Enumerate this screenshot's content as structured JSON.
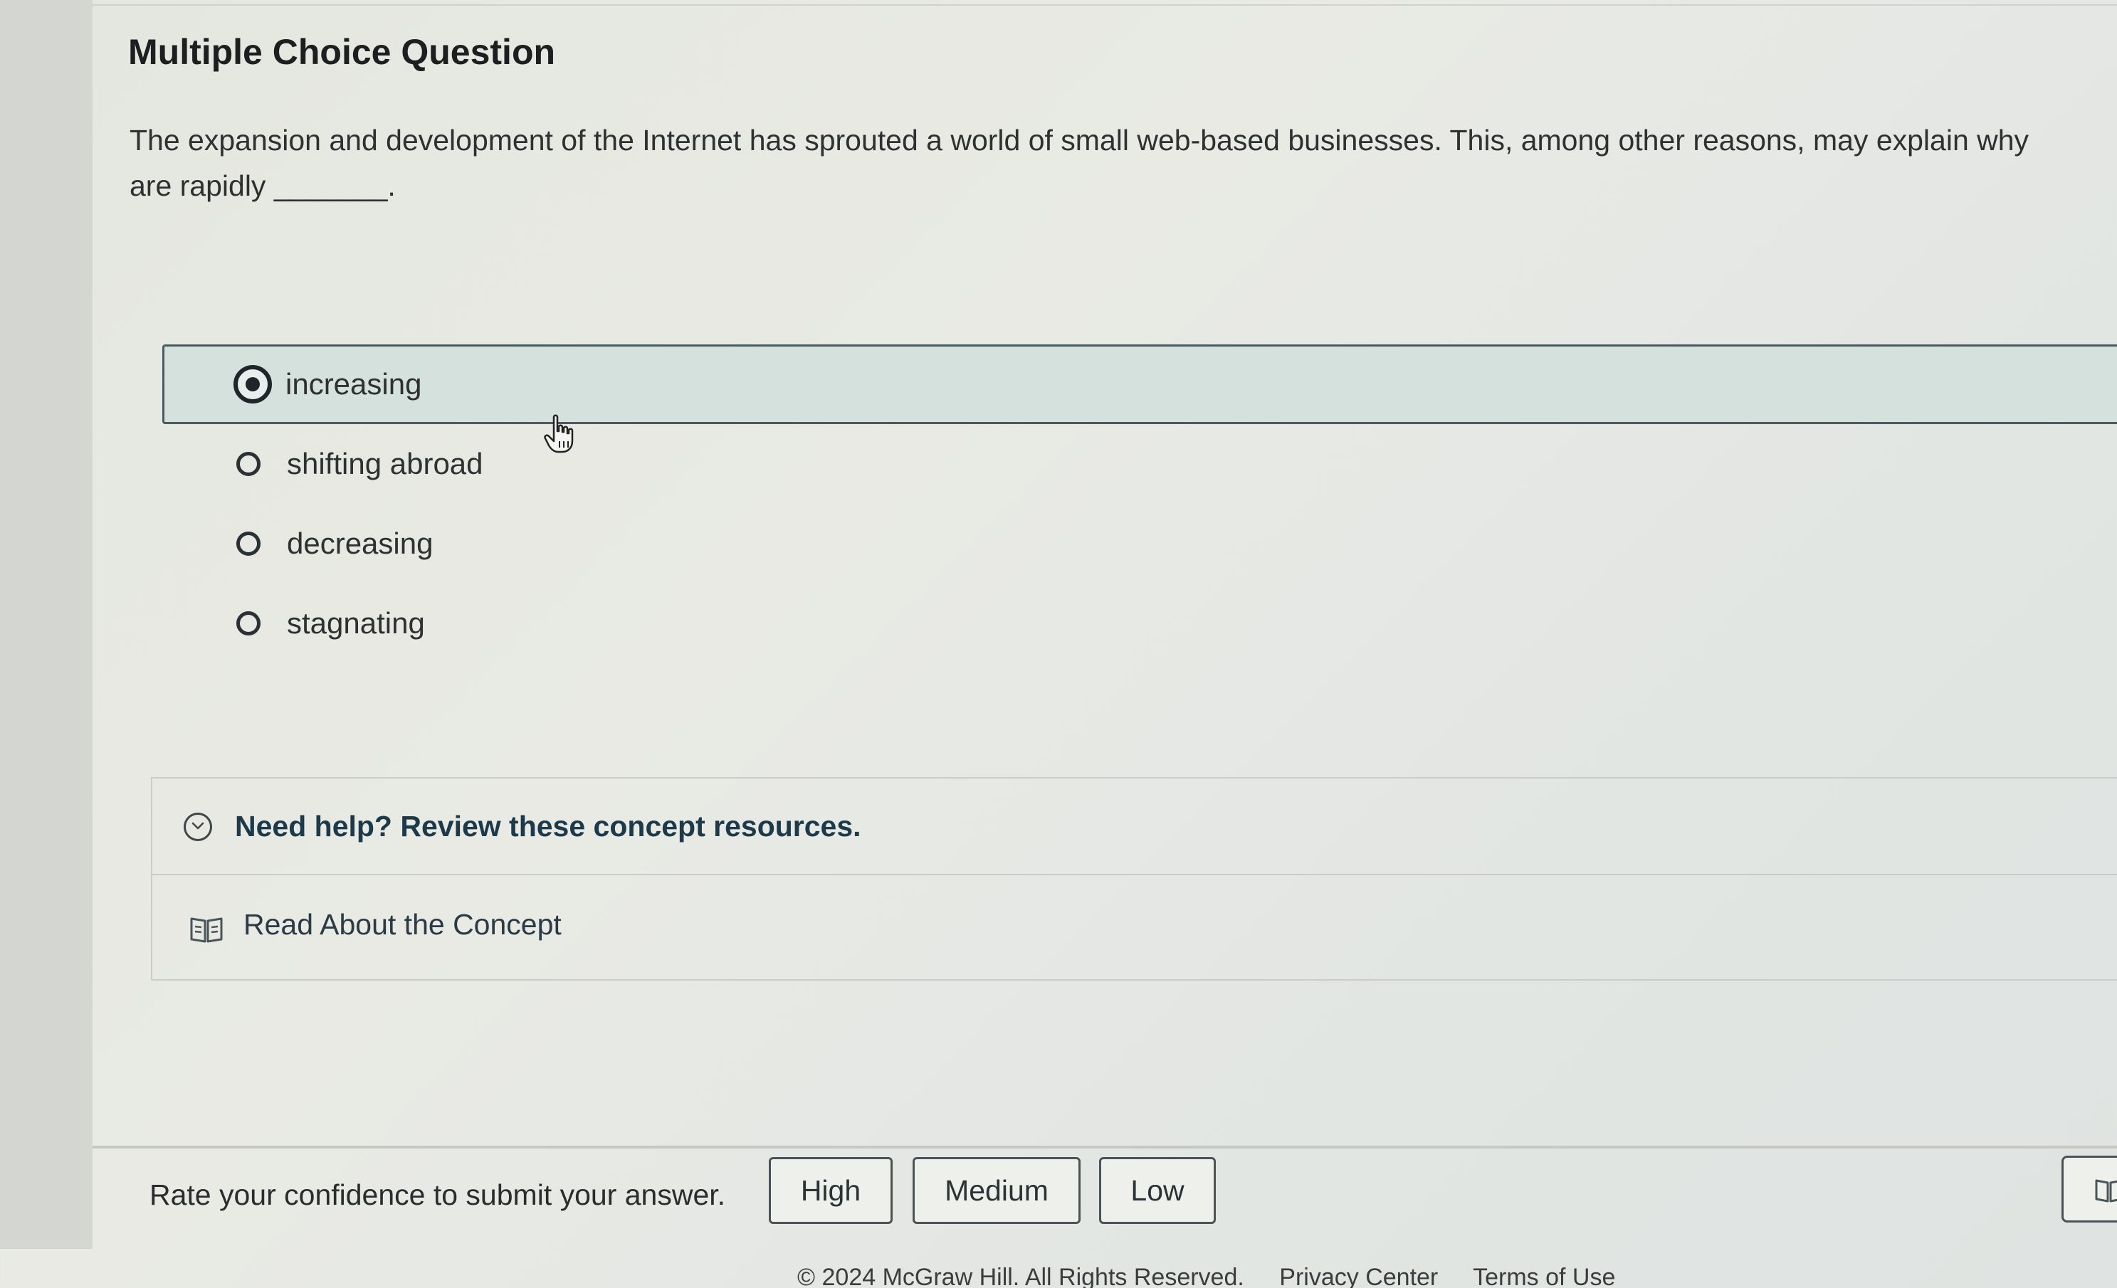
{
  "question": {
    "heading": "Multiple Choice Question",
    "prompt_line1": "The expansion and development of the Internet has sprouted a world of small web-based businesses. This, among other reasons, may explain why",
    "prompt_line2": "are rapidly _______."
  },
  "options": [
    {
      "label": "increasing",
      "selected": true
    },
    {
      "label": "shifting abroad",
      "selected": false
    },
    {
      "label": "decreasing",
      "selected": false
    },
    {
      "label": "stagnating",
      "selected": false
    }
  ],
  "help": {
    "title": "Need help? Review these concept resources.",
    "resource_label": "Read About the Concept"
  },
  "confidence": {
    "prompt": "Rate your confidence to submit your answer.",
    "high": "High",
    "medium": "Medium",
    "low": "Low"
  },
  "footer": {
    "copyright": "© 2024 McGraw Hill. All Rights Reserved.",
    "privacy": "Privacy Center",
    "terms": "Terms of Use"
  },
  "icons": {
    "chevron": "chevron-down-icon",
    "book": "book-icon",
    "cursor": "hand-cursor-icon"
  }
}
